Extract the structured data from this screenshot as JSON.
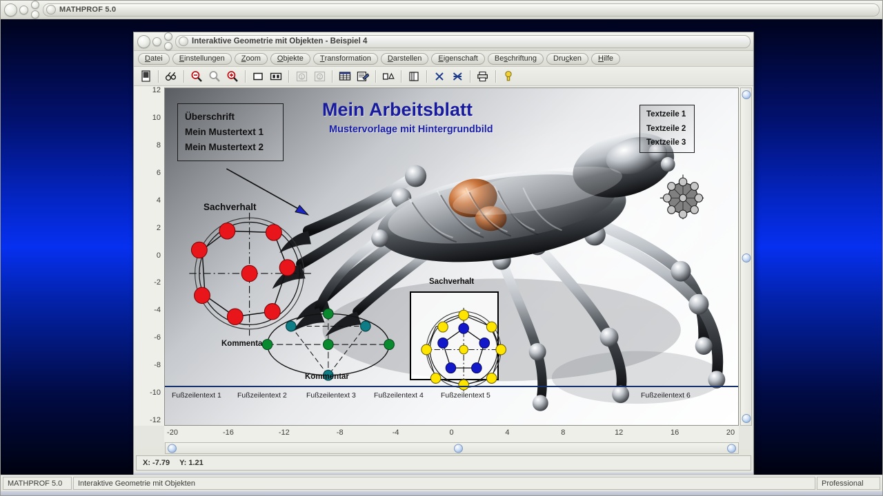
{
  "app": {
    "title": "MATHPROF 5.0",
    "status": {
      "program": "MATHPROF 5.0",
      "module": "Interaktive Geometrie mit Objekten",
      "edition": "Professional"
    }
  },
  "child_window": {
    "title": "Interaktive Geometrie mit Objekten - Beispiel 4",
    "menu": [
      {
        "label": "Datei",
        "accel": "D"
      },
      {
        "label": "Einstellungen",
        "accel": "E"
      },
      {
        "label": "Zoom",
        "accel": "Z"
      },
      {
        "label": "Objekte",
        "accel": "O"
      },
      {
        "label": "Transformation",
        "accel": "T"
      },
      {
        "label": "Darstellen",
        "accel": "D"
      },
      {
        "label": "Eigenschaft",
        "accel": "E"
      },
      {
        "label": "Beschriftung",
        "accel": "s"
      },
      {
        "label": "Drucken",
        "accel": "c"
      },
      {
        "label": "Hilfe",
        "accel": "H"
      }
    ],
    "toolbar": [
      {
        "name": "mode-button-icon",
        "title": "Modus"
      },
      {
        "name": "binoculars-icon",
        "title": "Betrachten"
      },
      {
        "name": "zoom-out-icon",
        "title": "Verkleinern"
      },
      {
        "name": "zoom-reset-icon",
        "title": "Originalgroesse"
      },
      {
        "name": "zoom-in-icon",
        "title": "Vergroessern"
      },
      {
        "name": "rectangle-icon",
        "title": "Rechteck"
      },
      {
        "name": "split-view-icon",
        "title": "Geteilte Ansicht"
      },
      {
        "name": "circle-one-icon",
        "title": "Objekt 1"
      },
      {
        "name": "circle-two-icon",
        "title": "Objekt 2"
      },
      {
        "name": "table-icon",
        "title": "Tabelle"
      },
      {
        "name": "worksheet-icon",
        "title": "Arbeitsblatt"
      },
      {
        "name": "shapes-icon",
        "title": "Formen"
      },
      {
        "name": "copy-icon",
        "title": "Kopieren"
      },
      {
        "name": "delete-x-icon",
        "title": "Loeschen"
      },
      {
        "name": "delete-all-x-icon",
        "title": "Alles loeschen"
      },
      {
        "name": "print-icon",
        "title": "Drucken"
      },
      {
        "name": "help-bulb-icon",
        "title": "Hilfe"
      }
    ],
    "status": {
      "x_label": "X: -7.79",
      "y_label": "Y: 1.21"
    }
  },
  "plot": {
    "y_ticks": [
      12,
      10,
      8,
      6,
      4,
      2,
      0,
      -2,
      -4,
      -6,
      -8,
      -10,
      -12
    ],
    "x_ticks": [
      -20,
      -16,
      -12,
      -8,
      -4,
      0,
      4,
      8,
      12,
      16,
      20
    ],
    "x_range": [
      -20,
      20
    ],
    "y_range": [
      -12,
      12
    ]
  },
  "worksheet": {
    "title": "Mein Arbeitsblatt",
    "subtitle": "Mustervorlage mit Hintergrundbild",
    "header_box": {
      "lines": [
        "Überschrift",
        "Mein Mustertext 1",
        "Mein Mustertext 2"
      ]
    },
    "right_box": {
      "lines": [
        "Textzeile 1",
        "Textzeile 2",
        "Textzeile 3"
      ]
    },
    "labels": {
      "circle_title": "Sachverhalt",
      "circle_comment": "Kommentar",
      "ellipse_comment": "Kommentar",
      "framed_title": "Sachverhalt"
    },
    "footer": [
      "Fußzeilentext 1",
      "Fußzeilentext 2",
      "Fußzeilentext 3",
      "Fußzeilentext 4",
      "Fußzeilentext 5",
      "Fußzeilentext 6"
    ],
    "colors": {
      "title": "#181c9c",
      "subtitle": "#1b20a8",
      "footer_rule": "#17306e",
      "point_red": "#e8161b",
      "point_green": "#0a8a2f",
      "point_teal": "#0f7d85",
      "point_yellow": "#ffe500",
      "point_blue": "#1318c8",
      "arrow_head": "#1a25c4",
      "octagon_fill": "#808080"
    }
  }
}
